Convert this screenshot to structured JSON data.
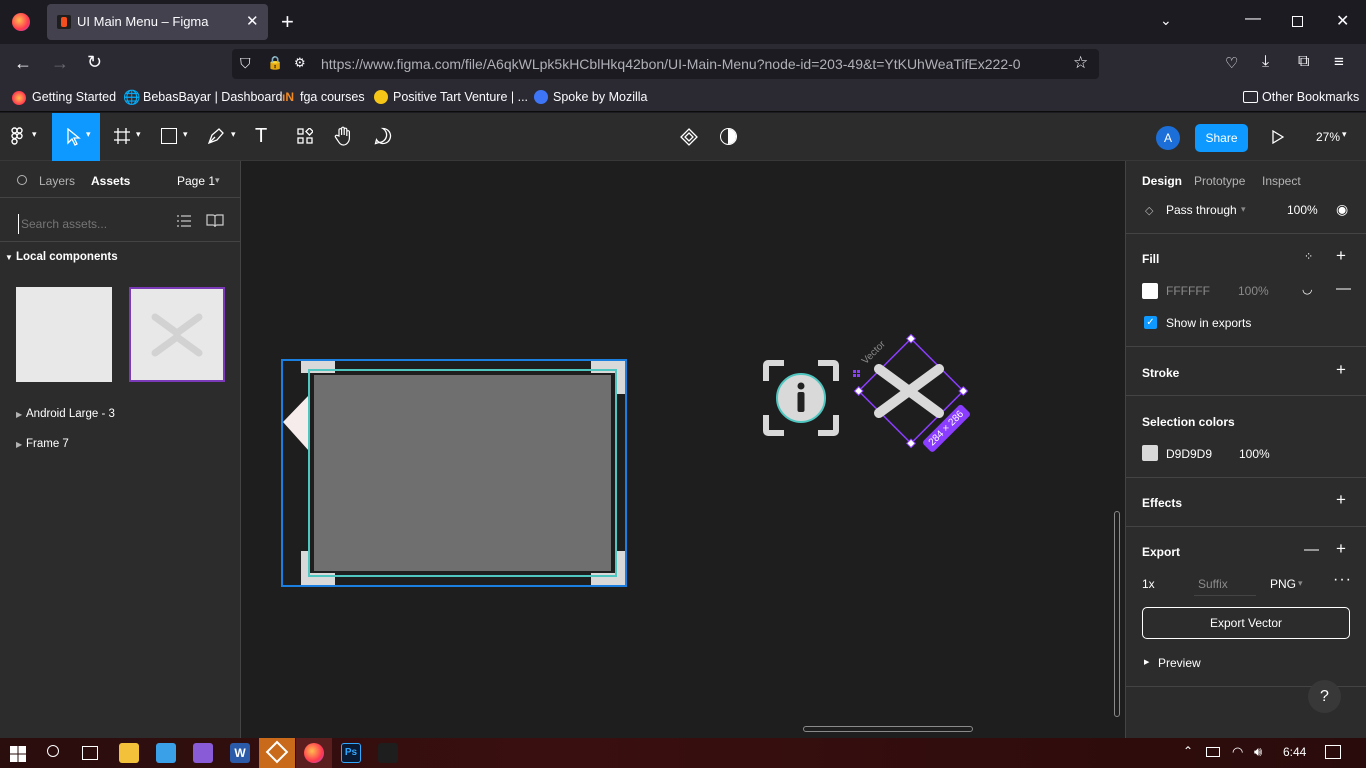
{
  "browser": {
    "tab_title": "UI Main Menu – Figma",
    "url": "https://www.figma.com/file/A6qkWLpk5kHCblHkq42bon/UI-Main-Menu?node-id=203-49&t=YtKUhWeaTifEx222-0",
    "bookmarks": [
      "Getting Started",
      "BebasBayar | Dashboard",
      "fga courses",
      "Positive Tart Venture | ...",
      "Spoke by Mozilla"
    ],
    "other_bookmarks": "Other Bookmarks"
  },
  "toolbar": {
    "avatar_letter": "A",
    "share_label": "Share",
    "zoom": "27%"
  },
  "left_panel": {
    "tab_layers": "Layers",
    "tab_assets": "Assets",
    "page_label": "Page 1",
    "search_placeholder": "Search assets...",
    "section_title": "Local components",
    "layers": [
      "Android Large - 3",
      "Frame 7"
    ]
  },
  "canvas": {
    "vector_label": "Vector",
    "dimension_badge": "284 × 286"
  },
  "right_panel": {
    "tabs": [
      "Design",
      "Prototype",
      "Inspect"
    ],
    "blend_mode": "Pass through",
    "opacity": "100%",
    "fill_title": "Fill",
    "fill_hex": "FFFFFF",
    "fill_opacity": "100%",
    "show_exports": "Show in exports",
    "stroke_title": "Stroke",
    "selection_colors_title": "Selection colors",
    "selection_hex": "D9D9D9",
    "selection_opacity": "100%",
    "effects_title": "Effects",
    "export_title": "Export",
    "export_scale": "1x",
    "export_suffix_placeholder": "Suffix",
    "export_format": "PNG",
    "export_button": "Export Vector",
    "preview_label": "Preview",
    "help_label": "?"
  },
  "taskbar": {
    "time": "6:44"
  },
  "colors": {
    "accent_blue": "#0d99ff",
    "selection_purple": "#8b3dff",
    "fill_white": "#ffffff",
    "selection_gray": "#d9d9d9"
  }
}
